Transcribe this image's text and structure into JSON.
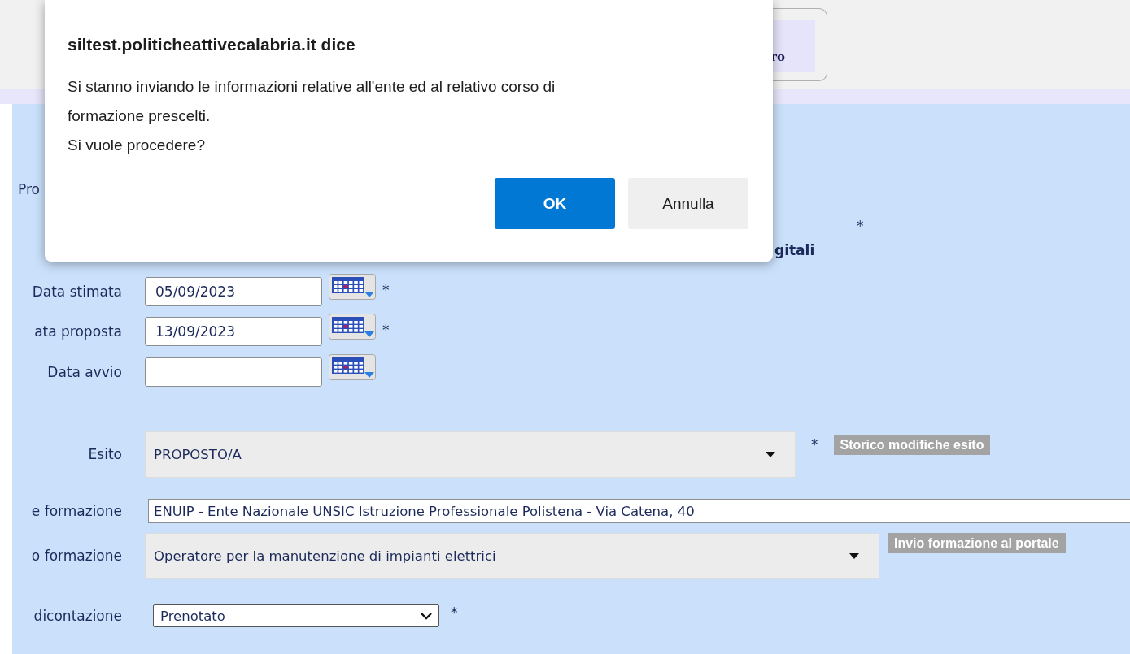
{
  "top_tab": {
    "label": "ro"
  },
  "behind_dialog": {
    "label": "Pro",
    "mark": "*",
    "heading": "gitali"
  },
  "fields": [
    {
      "kind": "date",
      "label": "Data stimata",
      "value": "05/09/2023",
      "mark": "*"
    },
    {
      "kind": "date",
      "label": "ata proposta",
      "value": "13/09/2023",
      "mark": "*"
    },
    {
      "kind": "date",
      "label": "Data avvio"
    },
    {
      "kind": "dropdown",
      "label": "Esito",
      "value": "PROPOSTO/A",
      "mark": "*",
      "action": "Storico modifiche esito"
    },
    {
      "kind": "text",
      "label": "e formazione",
      "value": "ENUIP - Ente Nazionale UNSIC Istruzione Professionale Polistena - Via Catena, 40"
    },
    {
      "kind": "dropdown",
      "label": "o formazione",
      "value": "Operatore per la manutenzione di impianti elettrici",
      "action": "Invio formazione al portale"
    },
    {
      "kind": "select",
      "label": "dicontazione",
      "value": "Prenotato",
      "mark": "*"
    }
  ],
  "dialog": {
    "title": "siltest.politicheattivecalabria.it dice",
    "message": [
      "Si stanno inviando le informazioni relative all'ente ed al relativo corso di",
      "formazione prescelti.",
      "Si vuole procedere?"
    ],
    "buttons": [
      {
        "label": "OK",
        "primary": true
      },
      {
        "label": "Annulla",
        "primary": false
      }
    ]
  }
}
